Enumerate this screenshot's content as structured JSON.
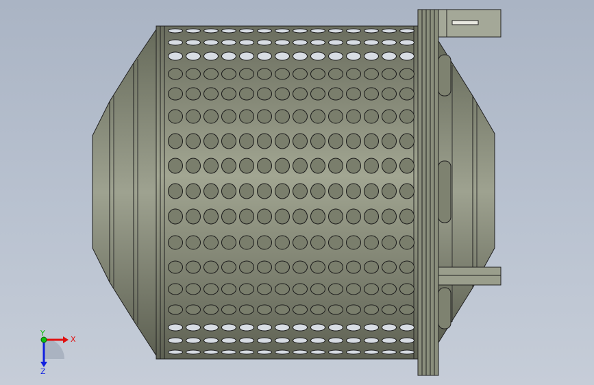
{
  "viewport": {
    "background_top": "#aab4c4",
    "background_bottom": "#c6cdd8"
  },
  "model": {
    "name": "perforated-drum-assembly",
    "body_color": "#8e9280",
    "body_dark": "#5a5d50",
    "edge_color": "#202020",
    "hole_fill": "#6e7262",
    "hole_light_fill": "#b9c2d0"
  },
  "triad": {
    "x_label": "X",
    "y_label": "Y",
    "z_label": "Z",
    "x_color": "#e01010",
    "y_color": "#10c010",
    "z_color": "#1020e0"
  }
}
